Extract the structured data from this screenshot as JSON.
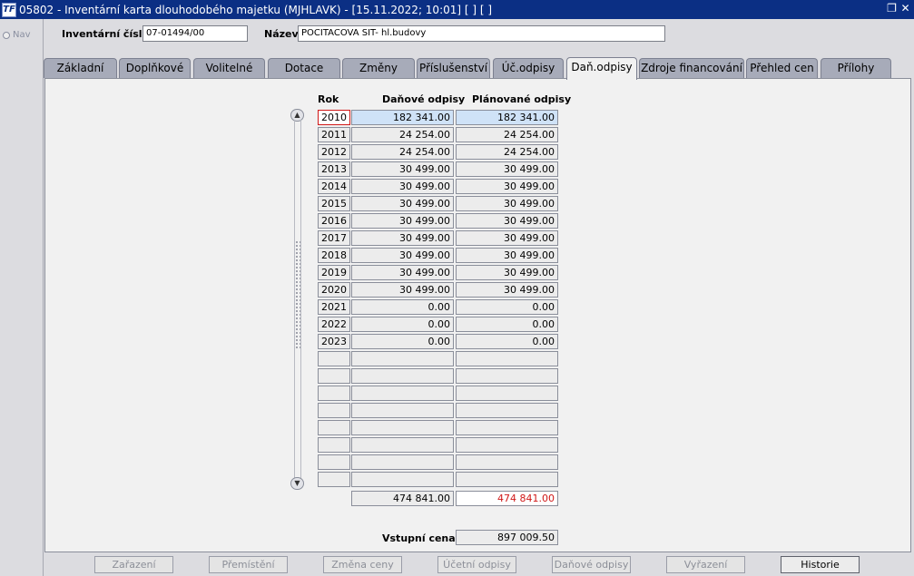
{
  "window": {
    "title": "05802 - Inventární karta dlouhodobého majetku (MJHLAVK) - [15.11.2022; 10:01] [ ] [ ]",
    "icon_text": "TF"
  },
  "nav": {
    "label": "Nav"
  },
  "header": {
    "inventory_label": "Inventární číslo",
    "inventory_value": "07-01494/00",
    "name_label": "Název",
    "name_value": "POCITACOVA SIT- hl.budovy"
  },
  "tabs": [
    {
      "label": "Základní"
    },
    {
      "label": "Doplňkové"
    },
    {
      "label": "Volitelné"
    },
    {
      "label": "Dotace"
    },
    {
      "label": "Změny"
    },
    {
      "label": "Příslušenství"
    },
    {
      "label": "Úč.odpisy"
    },
    {
      "label": "Daň.odpisy"
    },
    {
      "label": "Zdroje financování"
    },
    {
      "label": "Přehled cen"
    },
    {
      "label": "Přílohy"
    }
  ],
  "active_tab": "Daň.odpisy",
  "table": {
    "headers": {
      "year": "Rok",
      "tax": "Daňové odpisy",
      "planned": "Plánované odpisy"
    },
    "rows": [
      {
        "year": "2010",
        "tax": "182 341.00",
        "planned": "182 341.00"
      },
      {
        "year": "2011",
        "tax": "24 254.00",
        "planned": "24 254.00"
      },
      {
        "year": "2012",
        "tax": "24 254.00",
        "planned": "24 254.00"
      },
      {
        "year": "2013",
        "tax": "30 499.00",
        "planned": "30 499.00"
      },
      {
        "year": "2014",
        "tax": "30 499.00",
        "planned": "30 499.00"
      },
      {
        "year": "2015",
        "tax": "30 499.00",
        "planned": "30 499.00"
      },
      {
        "year": "2016",
        "tax": "30 499.00",
        "planned": "30 499.00"
      },
      {
        "year": "2017",
        "tax": "30 499.00",
        "planned": "30 499.00"
      },
      {
        "year": "2018",
        "tax": "30 499.00",
        "planned": "30 499.00"
      },
      {
        "year": "2019",
        "tax": "30 499.00",
        "planned": "30 499.00"
      },
      {
        "year": "2020",
        "tax": "30 499.00",
        "planned": "30 499.00"
      },
      {
        "year": "2021",
        "tax": "0.00",
        "planned": "0.00"
      },
      {
        "year": "2022",
        "tax": "0.00",
        "planned": "0.00"
      },
      {
        "year": "2023",
        "tax": "0.00",
        "planned": "0.00"
      },
      {
        "year": "",
        "tax": "",
        "planned": ""
      },
      {
        "year": "",
        "tax": "",
        "planned": ""
      },
      {
        "year": "",
        "tax": "",
        "planned": ""
      },
      {
        "year": "",
        "tax": "",
        "planned": ""
      },
      {
        "year": "",
        "tax": "",
        "planned": ""
      },
      {
        "year": "",
        "tax": "",
        "planned": ""
      },
      {
        "year": "",
        "tax": "",
        "planned": ""
      },
      {
        "year": "",
        "tax": "",
        "planned": ""
      }
    ],
    "totals": {
      "tax": "474 841.00",
      "planned": "474 841.00"
    }
  },
  "entry_price": {
    "label": "Vstupní cena",
    "value": "897 009.50"
  },
  "buttons": [
    {
      "label": "Zařazení",
      "enabled": false
    },
    {
      "label": "Přemístění",
      "enabled": false
    },
    {
      "label": "Změna ceny",
      "enabled": false
    },
    {
      "label": "Účetní odpisy",
      "enabled": false
    },
    {
      "label": "Daňové odpisy",
      "enabled": false
    },
    {
      "label": "Vyřazení",
      "enabled": false
    },
    {
      "label": "Historie",
      "enabled": true
    }
  ]
}
